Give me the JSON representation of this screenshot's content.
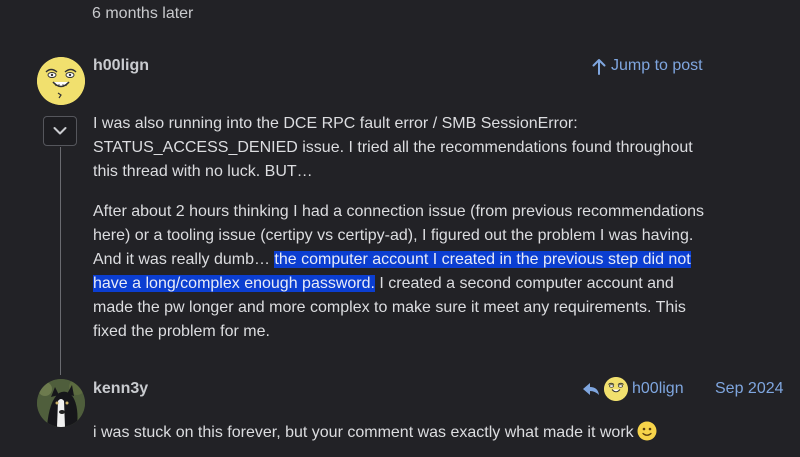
{
  "thread": {
    "time_gap": "6 months later"
  },
  "post1": {
    "username": "h00lign",
    "jump_label": "Jump to post",
    "para1": "I was also running into the DCE RPC fault error / SMB SessionError: STATUS_ACCESS_DENIED issue. I tried all the recommendations found throughout this thread with no luck. BUT…",
    "para2_before": "After about 2 hours thinking I had a connection issue (from previous recommendations here) or a tooling issue (certipy vs certipy-ad), I figured out the problem I was having. And it was really dumb…",
    "para2_highlight": "the computer account I created in the previous step did not have a long/complex enough password.",
    "para2_after": " I created a second computer account and made the pw longer and more complex to make sure it meet any requirements. This fixed the problem for me."
  },
  "post2": {
    "username": "kenn3y",
    "reply_to_username": "h00lign",
    "date": "Sep 2024",
    "text": "i was stuck on this forever, but your comment was exactly what made it work"
  },
  "icons": {
    "collapse": "chevron-down-icon",
    "jump": "arrow-up-icon",
    "reply": "reply-arrow-icon",
    "emoji": "slightly-smiling-face-icon"
  },
  "colors": {
    "background": "#222226",
    "link": "#7fa6df",
    "highlight": "#0b3ed1",
    "avatar_yellow": "#f1e06e"
  }
}
